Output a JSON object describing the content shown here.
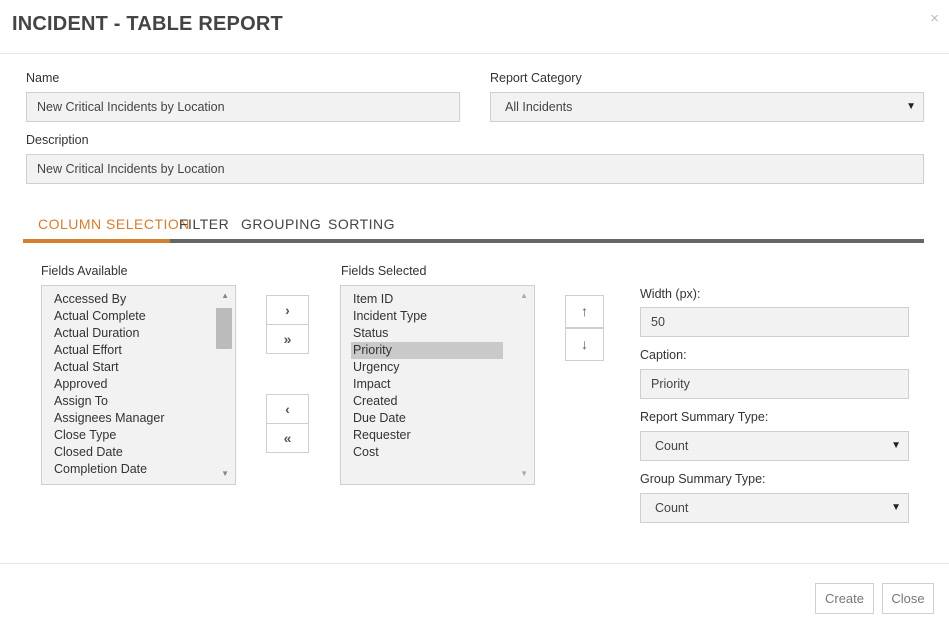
{
  "dialog": {
    "title": "INCIDENT - TABLE REPORT",
    "close_glyph": "×"
  },
  "form": {
    "name_label": "Name",
    "name_value": "New Critical Incidents by Location",
    "category_label": "Report Category",
    "category_value": "All Incidents",
    "description_label": "Description",
    "description_value": "New Critical Incidents by Location"
  },
  "tabs": [
    {
      "label": "COLUMN SELECTION",
      "active": true
    },
    {
      "label": "FILTER",
      "active": false
    },
    {
      "label": "GROUPING",
      "active": false
    },
    {
      "label": "SORTING",
      "active": false
    }
  ],
  "fields_available": {
    "label": "Fields Available",
    "items": [
      "Accessed By",
      "Actual Complete",
      "Actual Duration",
      "Actual Effort",
      "Actual Start",
      "Approved",
      "Assign To",
      "Assignees Manager",
      "Close Type",
      "Closed Date",
      "Completion Date"
    ]
  },
  "fields_selected": {
    "label": "Fields Selected",
    "items": [
      "Item ID",
      "Incident Type",
      "Status",
      "Priority",
      "Urgency",
      "Impact",
      "Created",
      "Due Date",
      "Requester",
      "Cost"
    ],
    "selected": "Priority"
  },
  "transfer_buttons": {
    "add_one": "›",
    "add_all": "»",
    "remove_one": "‹",
    "remove_all": "«"
  },
  "order_buttons": {
    "up": "↑",
    "down": "↓"
  },
  "properties": {
    "width_label": "Width (px):",
    "width_value": "50",
    "caption_label": "Caption:",
    "caption_value": "Priority",
    "report_summary_label": "Report Summary Type:",
    "report_summary_value": "Count",
    "group_summary_label": "Group Summary Type:",
    "group_summary_value": "Count"
  },
  "footer": {
    "create_label": "Create",
    "close_label": "Close"
  },
  "colors": {
    "accent": "#d47e30",
    "field_bg": "#f2f2f2",
    "selected_row": "#c9c9c9"
  }
}
